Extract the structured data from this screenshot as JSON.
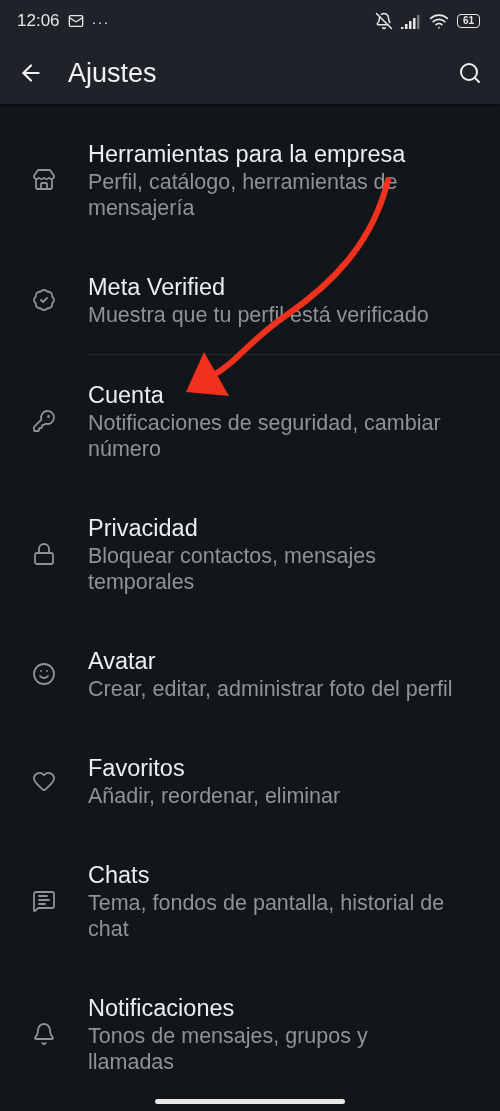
{
  "status_bar": {
    "time": "12:06",
    "more": "···",
    "battery": "61"
  },
  "header": {
    "title": "Ajustes"
  },
  "sections": [
    {
      "items": [
        {
          "kind": "store",
          "title": "Herramientas para la empresa",
          "subtitle": "Perfil, catálogo, herramientas de mensajería"
        },
        {
          "kind": "verified",
          "title": "Meta Verified",
          "subtitle": "Muestra que tu perfil está verificado"
        }
      ]
    },
    {
      "items": [
        {
          "kind": "key",
          "title": "Cuenta",
          "subtitle": "Notificaciones de seguridad, cambiar número"
        },
        {
          "kind": "lock",
          "title": "Privacidad",
          "subtitle": "Bloquear contactos, mensajes temporales"
        },
        {
          "kind": "avatar",
          "title": "Avatar",
          "subtitle": "Crear, editar, administrar foto del perfil"
        },
        {
          "kind": "heart",
          "title": "Favoritos",
          "subtitle": "Añadir, reordenar, eliminar"
        },
        {
          "kind": "chat",
          "title": "Chats",
          "subtitle": "Tema, fondos de pantalla, historial de chat"
        },
        {
          "kind": "bell",
          "title": "Notificaciones",
          "subtitle": "Tonos de mensajes, grupos y llamadas"
        }
      ]
    }
  ]
}
